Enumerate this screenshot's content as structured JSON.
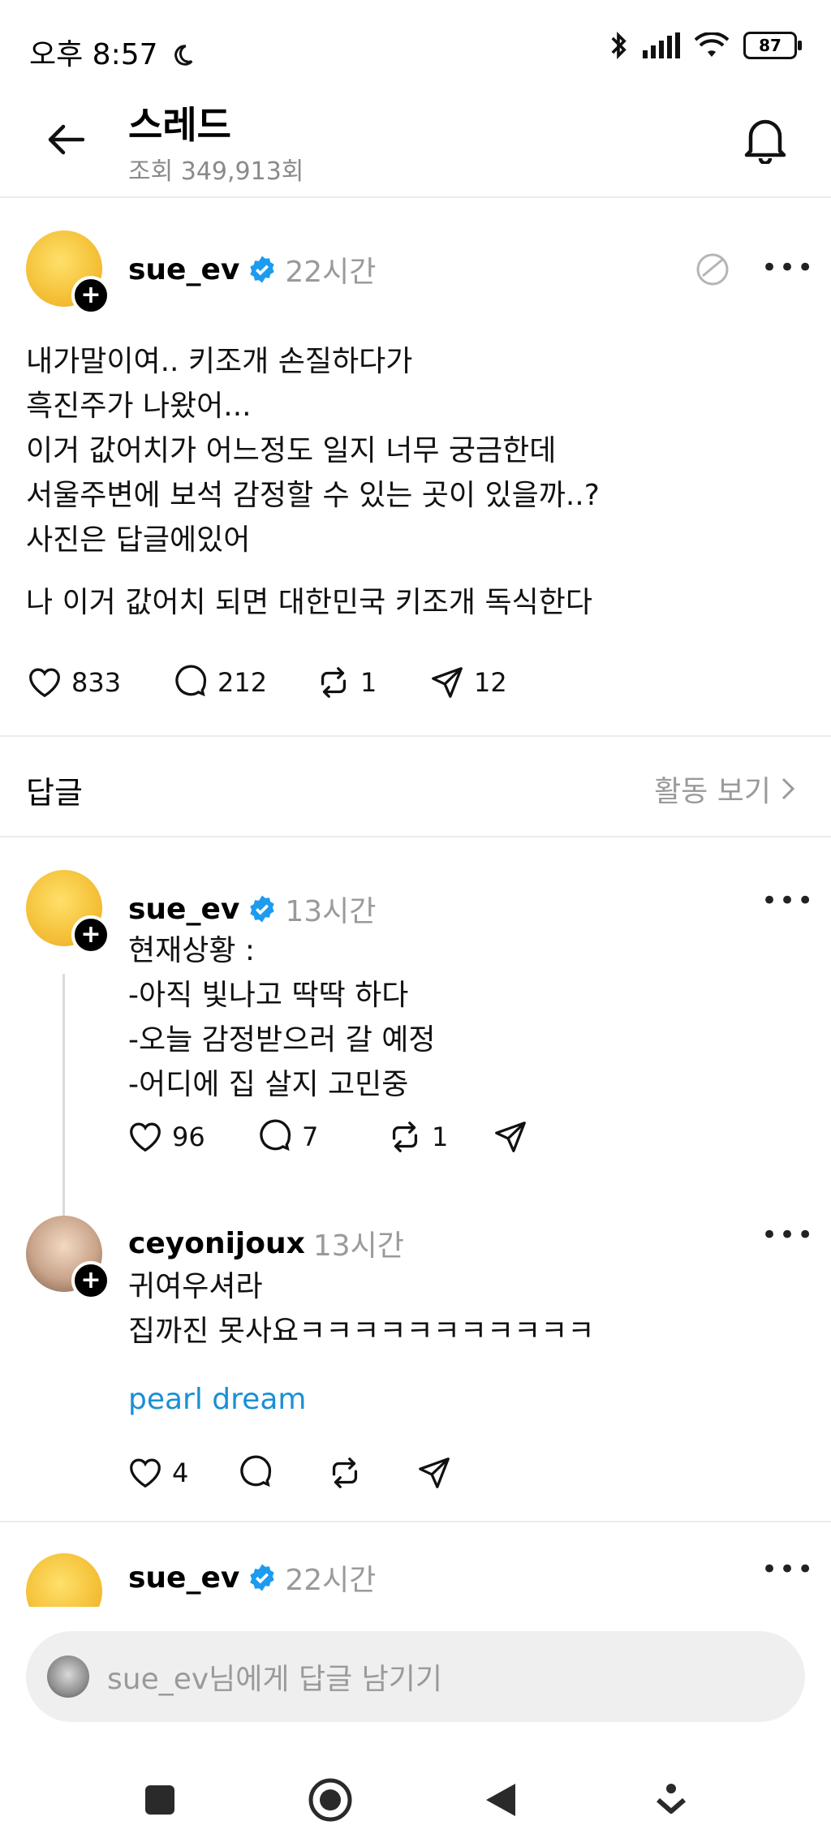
{
  "status_bar": {
    "time": "오후 8:57",
    "battery": "87",
    "icons": [
      "moon-icon",
      "bluetooth-icon",
      "signal-icon",
      "wifi-icon",
      "battery-icon"
    ]
  },
  "header": {
    "title": "스레드",
    "views": "조회 349,913회",
    "icons": [
      "back-arrow-icon",
      "bell-icon"
    ]
  },
  "main_post": {
    "username": "sue_ev",
    "time": "22시간",
    "lines": [
      "내가말이여.. 키조개 손질하다가",
      "흑진주가 나왔어...",
      "이거 값어치가 어느정도 일지 너무 궁금한데",
      "서울주변에 보석 감정할 수 있는 곳이 있을까..?",
      "사진은 답글에있어"
    ],
    "last_line": "나 이거 값어치 되면 대한민국 키조개 독식한다",
    "likes": "833",
    "comments": "212",
    "reposts": "1",
    "shares": "12"
  },
  "replies_section": {
    "title": "답글",
    "activity_link": "활동 보기"
  },
  "reply1": {
    "username": "sue_ev",
    "time": "13시간",
    "lines": [
      "현재상황 :",
      "-아직 빛나고 딱딱 하다",
      "-오늘 감정받으러 갈 예정",
      "-어디에 집 살지 고민중"
    ],
    "likes": "96",
    "comments": "7",
    "reposts": "1"
  },
  "reply2": {
    "username": "ceyonijoux",
    "time": "13시간",
    "lines": [
      "귀여우셔라",
      "집까진 못사요ㅋㅋㅋㅋㅋㅋㅋㅋㅋㅋㅋ"
    ],
    "link_text": "pearl dream",
    "likes": "4"
  },
  "reply3": {
    "username": "sue_ev",
    "time": "22시간"
  },
  "composer": {
    "placeholder": "sue_ev님에게 답글 남기기"
  },
  "colors": {
    "verified": "#1d9bf0",
    "link": "#1a8fd6",
    "muted": "#9a9a9a"
  }
}
